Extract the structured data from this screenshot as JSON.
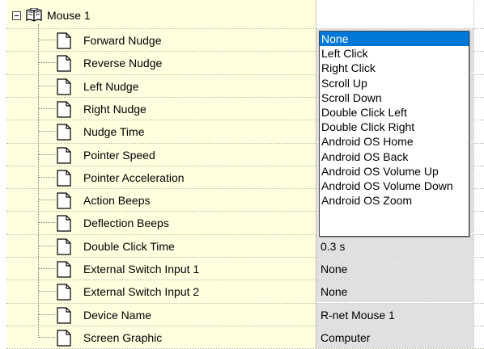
{
  "tree": {
    "root_label": "Mouse 1",
    "rows": [
      {
        "label": "Forward Nudge",
        "value": ""
      },
      {
        "label": "Reverse Nudge",
        "value": ""
      },
      {
        "label": "Left Nudge",
        "value": ""
      },
      {
        "label": "Right Nudge",
        "value": ""
      },
      {
        "label": "Nudge Time",
        "value": ""
      },
      {
        "label": "Pointer Speed",
        "value": ""
      },
      {
        "label": "Pointer Acceleration",
        "value": ""
      },
      {
        "label": "Action Beeps",
        "value": ""
      },
      {
        "label": "Deflection Beeps",
        "value": ""
      },
      {
        "label": "Double Click Time",
        "value": "0.3 s"
      },
      {
        "label": "External Switch Input 1",
        "value": "None"
      },
      {
        "label": "External Switch Input 2",
        "value": "None"
      },
      {
        "label": "Device Name",
        "value": "R-net Mouse 1"
      },
      {
        "label": "Screen Graphic",
        "value": "Computer"
      }
    ]
  },
  "dropdown": {
    "selected": "None",
    "options": [
      "None",
      "Left Click",
      "Right Click",
      "Scroll Up",
      "Scroll Down",
      "Double Click Left",
      "Double Click Right",
      "Android OS Home",
      "Android OS Back",
      "Android OS Volume Up",
      "Android OS Volume Down",
      "Android OS Zoom"
    ]
  },
  "colors": {
    "label_column_bg": "#ffffe0",
    "value_cell_bg": "#e0e0e0",
    "selection_bg": "#0078d7"
  },
  "icons": {
    "root_toggle": "collapse-minus-icon",
    "root": "open-book-icon",
    "row": "document-icon"
  }
}
